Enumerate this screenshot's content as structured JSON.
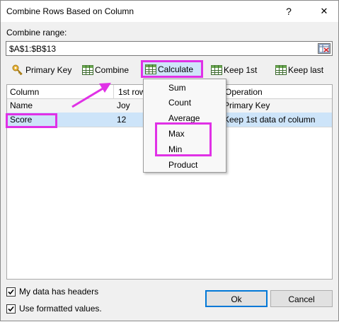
{
  "window": {
    "title": "Combine Rows Based on Column",
    "help": "?",
    "close": "✕"
  },
  "range": {
    "label": "Combine range:",
    "value": "$A$1:$B$13"
  },
  "toolbar": {
    "primary_key": "Primary Key",
    "combine": "Combine",
    "calculate": "Calculate",
    "keep_first": "Keep 1st",
    "keep_last": "Keep last"
  },
  "grid": {
    "headers": [
      "Column",
      "1st row",
      "Operation"
    ],
    "rows": [
      [
        "Name",
        "Joy",
        "Primary Key"
      ],
      [
        "Score",
        "12",
        "Keep 1st data of column"
      ]
    ]
  },
  "calc_menu": [
    "Sum",
    "Count",
    "Average",
    "Max",
    "Min",
    "Product"
  ],
  "options": {
    "headers": {
      "label": "My data has headers",
      "checked": true
    },
    "formatted": {
      "label": "Use formatted values.",
      "checked": true
    }
  },
  "buttons": {
    "ok": "Ok",
    "cancel": "Cancel"
  },
  "colors": {
    "highlight": "#e031e6",
    "selection": "#cde4f9",
    "accent": "#0078d7"
  }
}
